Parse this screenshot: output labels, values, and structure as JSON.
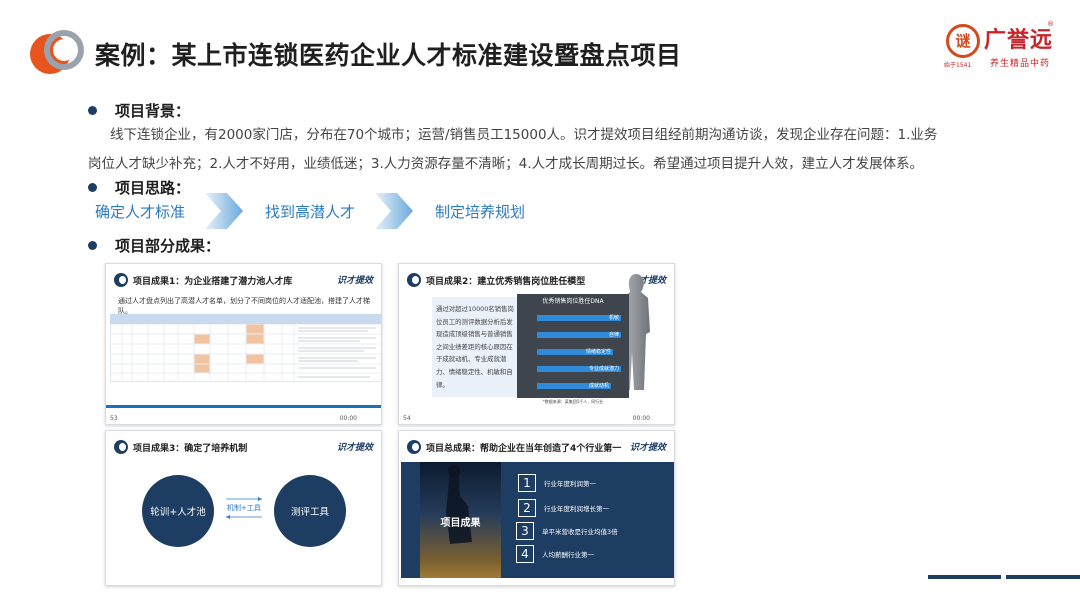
{
  "header": {
    "title": "案例：某上市连锁医药企业人才标准建设暨盘点项目",
    "brand": {
      "seal": "谜",
      "name": "广誉远",
      "reg": "®",
      "small": "始于1541",
      "slogan": "养生精品中药"
    }
  },
  "sections": {
    "background": {
      "title": "项目背景：",
      "text": "线下连锁企业，有2000家门店，分布在70个城市；运营/销售员工15000人。识才提效项目组经前期沟通访谈，发现企业存在问题：1.业务岗位人才缺少补充；2.人才不好用，业绩低迷；3.人力资源存量不清晰；4.人才成长周期过长。希望通过项目提升人效，建立人才发展体系。"
    },
    "approach": {
      "title": "项目思路：",
      "steps": [
        "确定人才标准",
        "找到高潜人才",
        "制定培养规划"
      ]
    },
    "results": {
      "title": "项目部分成果："
    }
  },
  "slides": {
    "logo_text": "识才提效",
    "s1": {
      "title": "项目成果1：为企业搭建了潜力池人才库",
      "subtitle": "通过人才盘点列出了高潜人才名单，划分了不同岗位的人才适配池，搭建了人才梯队。",
      "page": "53",
      "time": "00:00"
    },
    "s2": {
      "title": "项目成果2：建立优秀销售岗位胜任模型",
      "text": "通过对超过10000名销售岗位员工的测评数据分析后发现造成顶级销售与普通销售之间业绩差距的核心原因在于成就动机、专业成就潜力、情绪稳定性、机敏和自律。",
      "chart_title": "优秀销售岗位胜任DNA",
      "bars": [
        "机敏",
        "自律",
        "情绪稳定性",
        "专业成就潜力",
        "成就动机"
      ],
      "note": "*数据来源：某集团5千人、同行业",
      "page": "54",
      "time": "00:00"
    },
    "s3": {
      "title": "项目成果3：确定了培养机制",
      "left": "轮训+人才池",
      "middle": "机制+工具",
      "right": "测评工具"
    },
    "s4": {
      "title": "项目总成果：帮助企业在当年创造了4个行业第一",
      "photo_label": "项目成果",
      "ranks": [
        {
          "num": "1",
          "text": "行业年度利润第一"
        },
        {
          "num": "2",
          "text": "行业年度利润增长第一"
        },
        {
          "num": "3",
          "text": "单平米营收是行业均值3倍"
        },
        {
          "num": "4",
          "text": "人均薪酬行业第一"
        }
      ]
    }
  }
}
